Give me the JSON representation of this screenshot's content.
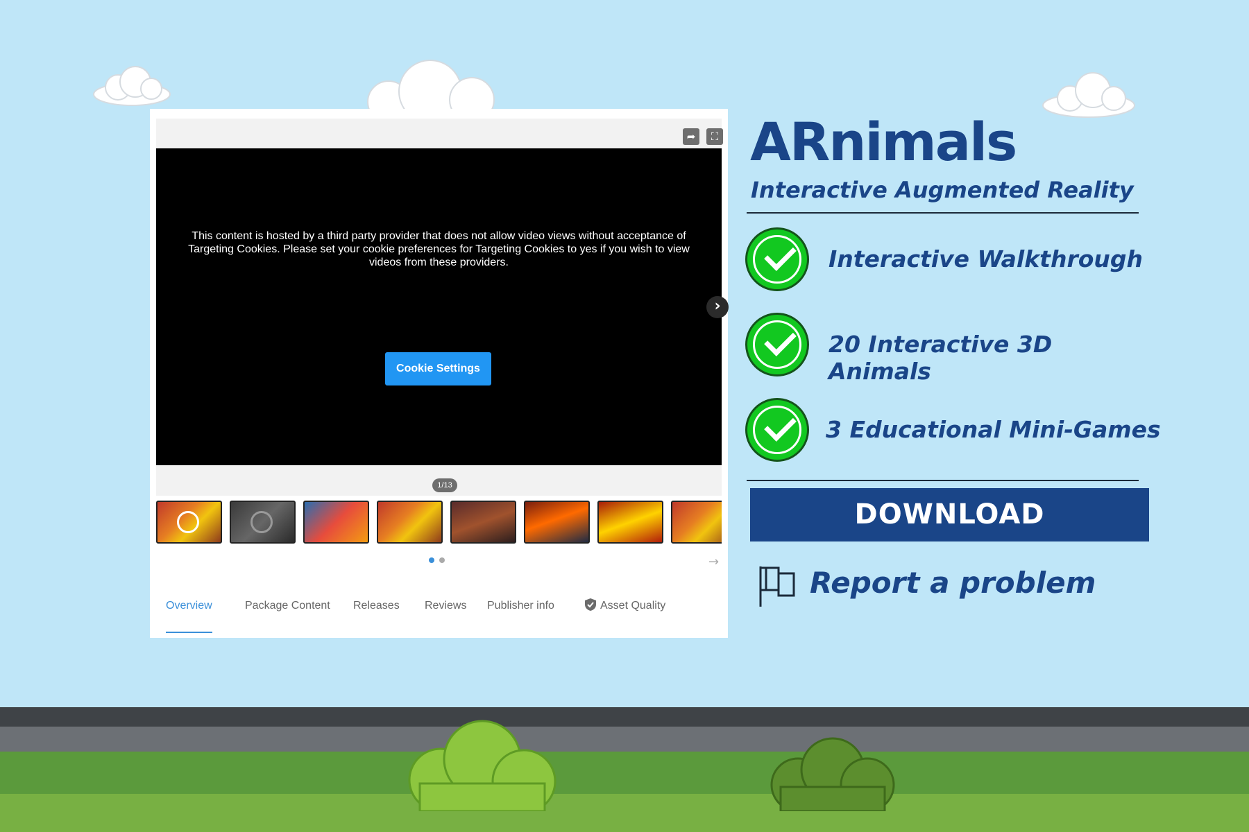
{
  "widget": {
    "player_message": "This content is hosted by a third party provider that does not allow video views without acceptance of Targeting Cookies. Please set your cookie preferences for Targeting Cookies to yes if you wish to view videos from these providers.",
    "cookie_button": "Cookie Settings",
    "counter": "1/13",
    "tabs": [
      "Overview",
      "Package Content",
      "Releases",
      "Reviews",
      "Publisher info",
      "Asset Quality"
    ],
    "active_tab": "Overview",
    "accent_color": "#2196f3"
  },
  "panel": {
    "title": "ARnimals",
    "subtitle": "Interactive Augmented Reality",
    "features": [
      "Interactive Walkthrough",
      "20 Interactive 3D Animals",
      "3 Educational Mini-Games"
    ],
    "download_label": "DOWNLOAD",
    "report_label": "Report a problem",
    "brand_color": "#1a4588",
    "check_color": "#12c820"
  }
}
